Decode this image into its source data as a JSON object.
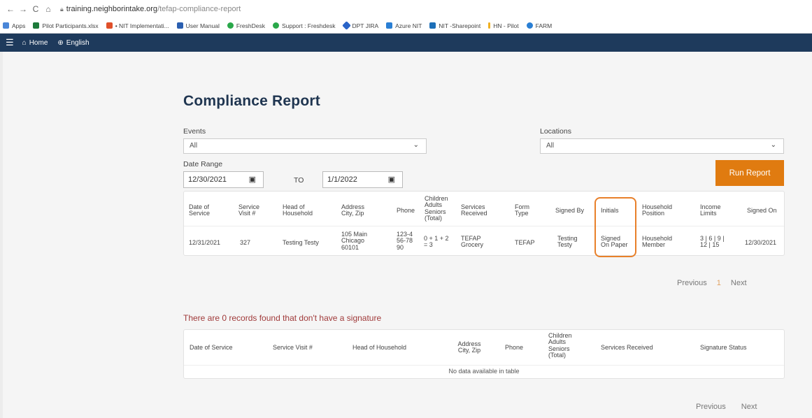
{
  "browser": {
    "url_host": "training.neighborintake.org",
    "url_path": "/tefap-compliance-report",
    "bookmarks": [
      "Apps",
      "Pilot Participants.xlsx",
      "• NIT Implementati...",
      "User Manual",
      "FreshDesk",
      "Support : Freshdesk",
      "DPT JIRA",
      "Azure NIT",
      "NIT -Sharepoint",
      "HN - Pilot",
      "FARM"
    ]
  },
  "appbar": {
    "home": "Home",
    "language": "English"
  },
  "page": {
    "title": "Compliance Report",
    "events_label": "Events",
    "events_value": "All",
    "locations_label": "Locations",
    "locations_value": "All",
    "date_range_label": "Date Range",
    "start_date": "12/30/2021",
    "to_label": "TO",
    "end_date": "1/1/2022",
    "run_button": "Run Report"
  },
  "table1": {
    "headers": [
      "Date of Service",
      "Service Visit #",
      "Head of Household",
      "Address City, Zip",
      "Phone",
      "Children Adults Seniors (Total)",
      "Services Received",
      "Form Type",
      "Signed By",
      "Initials",
      "Household Position",
      "Income Limits",
      "Signed On"
    ],
    "row": [
      "12/31/2021",
      "327",
      "Testing Testy",
      "105 Main Chicago 60101",
      "123-456-7890",
      "0 + 1 + 2 = 3",
      "TEFAP Grocery",
      "TEFAP",
      "Testing Testy",
      "Signed On Paper",
      "Household Member",
      "3 | 6 | 9 | 12 | 15",
      "12/30/2021"
    ]
  },
  "pager1": {
    "prev": "Previous",
    "page": "1",
    "next": "Next"
  },
  "nosig_message": "There are 0 records found that don't have a signature",
  "table2": {
    "headers": [
      "Date of Service",
      "Service Visit #",
      "Head of Household",
      "Address City, Zip",
      "Phone",
      "Children Adults Seniors (Total)",
      "Services Received",
      "Signature Status"
    ],
    "empty": "No data available in table"
  },
  "pager2": {
    "prev": "Previous",
    "next": "Next"
  },
  "colors": {
    "accent": "#e07b10",
    "navbar": "#1e3a5c",
    "title": "#1f3550",
    "highlight": "#e8802a",
    "warning_text": "#a03a3a"
  }
}
